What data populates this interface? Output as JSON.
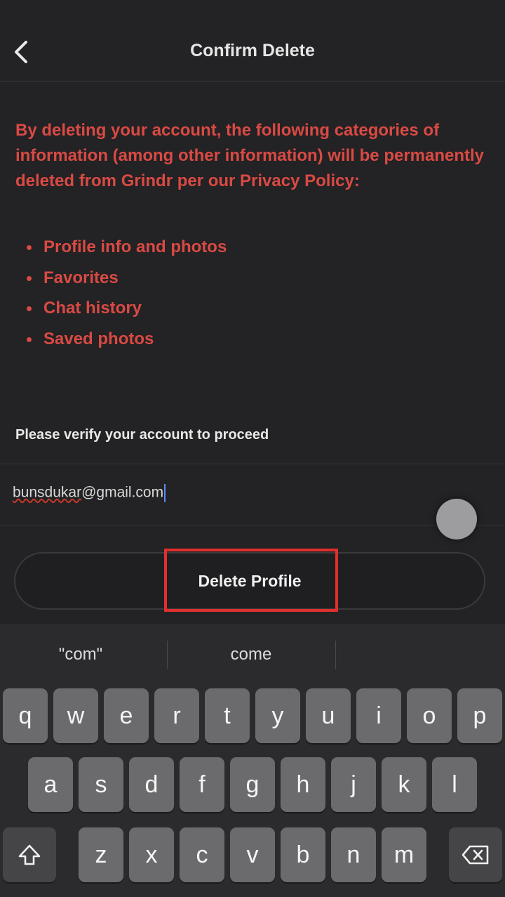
{
  "header": {
    "title": "Confirm Delete",
    "back_icon": "chevron-left-icon"
  },
  "warning": {
    "text": "By deleting your account, the following categories of information (among other information) will be permanently deleted from Grindr per our Privacy Policy:",
    "items": [
      "Profile info and photos",
      "Favorites",
      "Chat history",
      "Saved photos"
    ],
    "color": "#d94a44"
  },
  "verify": {
    "prompt": "Please verify your account to proceed",
    "email_user": "bunsdukar",
    "email_domain": "@gmail.com"
  },
  "actions": {
    "delete_label": "Delete Profile"
  },
  "keyboard": {
    "suggestions": [
      "\"com\"",
      "come"
    ],
    "row1": [
      "q",
      "w",
      "e",
      "r",
      "t",
      "y",
      "u",
      "i",
      "o",
      "p"
    ],
    "row2": [
      "a",
      "s",
      "d",
      "f",
      "g",
      "h",
      "j",
      "k",
      "l"
    ],
    "row3": [
      "z",
      "x",
      "c",
      "v",
      "b",
      "n",
      "m"
    ],
    "shift_icon": "shift-icon",
    "backspace_icon": "backspace-icon"
  }
}
